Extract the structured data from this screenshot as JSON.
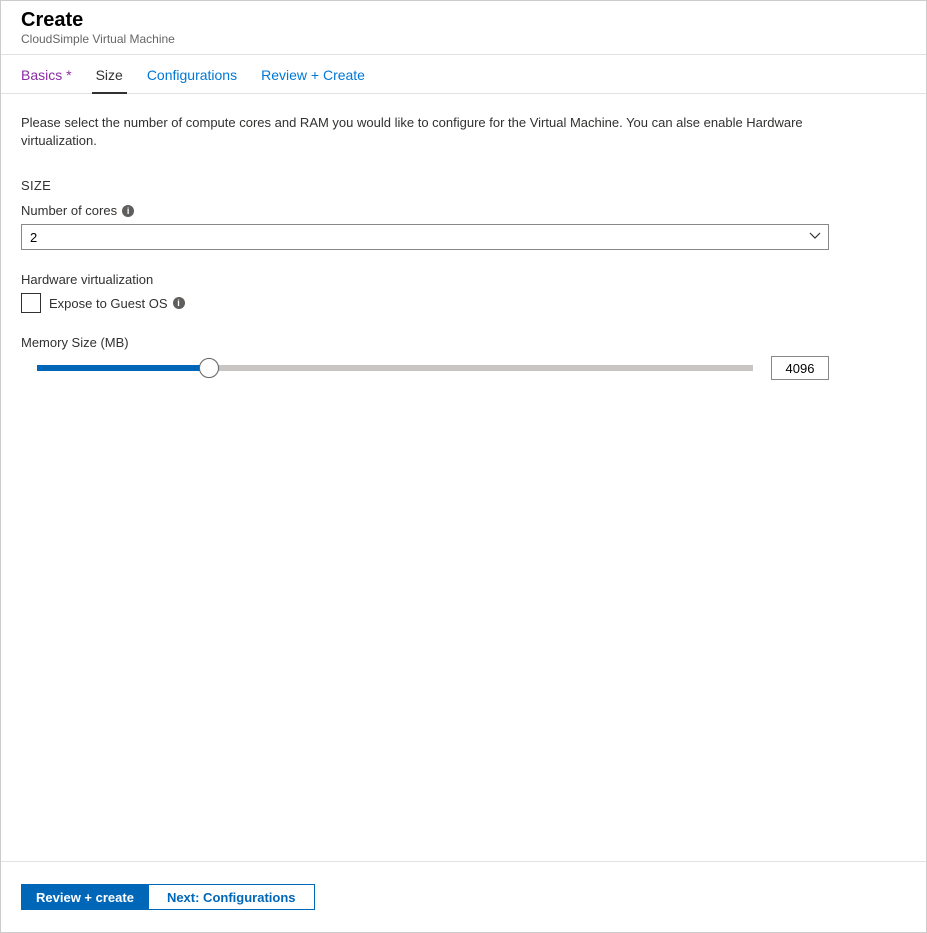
{
  "header": {
    "title": "Create",
    "subtitle": "CloudSimple Virtual Machine"
  },
  "tabs": {
    "items": [
      {
        "label": "Basics *",
        "state": "visited"
      },
      {
        "label": "Size",
        "state": "active"
      },
      {
        "label": "Configurations",
        "state": "default"
      },
      {
        "label": "Review + Create",
        "state": "default"
      }
    ]
  },
  "content": {
    "description": "Please select the number of compute cores and RAM you would like to configure for the Virtual Machine. You can alse enable Hardware virtualization.",
    "section_title": "SIZE",
    "cores": {
      "label": "Number of cores",
      "value": "2"
    },
    "hwvirt": {
      "heading": "Hardware virtualization",
      "checkbox_label": "Expose to Guest OS",
      "checked": false
    },
    "memory": {
      "label": "Memory Size (MB)",
      "value": "4096",
      "fill_percent": 24
    }
  },
  "footer": {
    "primary": "Review + create",
    "secondary": "Next: Configurations"
  }
}
